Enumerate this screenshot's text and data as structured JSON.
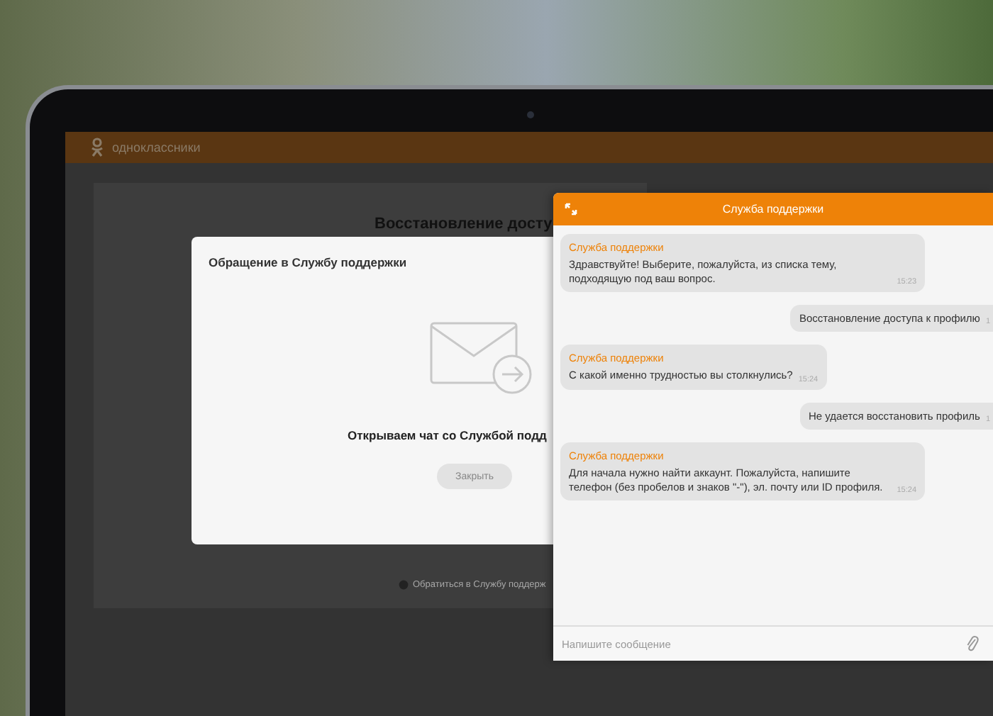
{
  "site": {
    "logo_text": "одноклассники"
  },
  "page": {
    "heading": "Восстановление досту",
    "footer_link": "Обратиться в Службу поддерж"
  },
  "modal": {
    "title": "Обращение в Службу поддержки",
    "message": "Открываем чат со Службой подд",
    "close_button": "Закрыть"
  },
  "chat": {
    "title": "Служба поддержки",
    "messages": [
      {
        "kind": "incoming",
        "sender": "Служба поддержки",
        "text": "Здравствуйте! Выберите, пожалуйста, из списка тему, подходящую под ваш вопрос.",
        "time": "15:23"
      },
      {
        "kind": "outgoing",
        "text": "Восстановление доступа к профилю",
        "time": "1"
      },
      {
        "kind": "incoming",
        "sender": "Служба поддержки",
        "text": "С какой именно трудностью вы столкнулись?",
        "time": "15:24"
      },
      {
        "kind": "outgoing",
        "text": "Не удается восстановить профиль",
        "time": "1"
      },
      {
        "kind": "incoming",
        "sender": "Служба поддержки",
        "text": "Для начала нужно найти аккаунт. Пожалуйста, напишите телефон (без пробелов и знаков \"-\"), эл. почту или ID профиля.",
        "time": "15:24"
      }
    ],
    "input": {
      "placeholder": "Напишите сообщение"
    }
  }
}
